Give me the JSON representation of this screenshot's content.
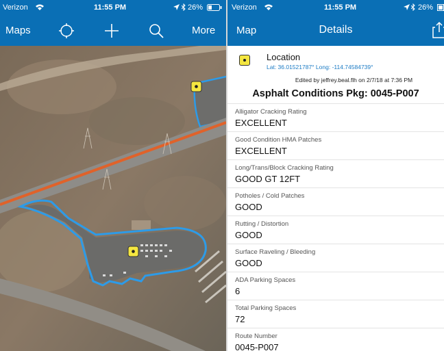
{
  "left": {
    "status": {
      "carrier": "Verizon",
      "time": "11:55 PM",
      "battery": "26%"
    },
    "nav": {
      "maps_label": "Maps",
      "more_label": "More"
    }
  },
  "right": {
    "status": {
      "carrier": "Verizon",
      "time": "11:55 PM",
      "battery": "26%"
    },
    "nav": {
      "back_label": "Map",
      "title": "Details"
    },
    "location": {
      "title": "Location",
      "coords": "Lat: 36.01521787° Long: -114.74584739°",
      "edited": "Edited by jeffrey.beal.flh on 2/7/18 at 7:36 PM"
    },
    "package_title": "Asphalt Conditions Pkg: 0045-P007",
    "fields": [
      {
        "label": "Alligator Cracking Rating",
        "value": "EXCELLENT"
      },
      {
        "label": "Good Condition HMA Patches",
        "value": "EXCELLENT"
      },
      {
        "label": "Long/Trans/Block Cracking Rating",
        "value": "GOOD GT 12FT"
      },
      {
        "label": "Potholes / Cold Patches",
        "value": "GOOD"
      },
      {
        "label": "Rutting / Distortion",
        "value": "GOOD"
      },
      {
        "label": "Surface Raveling / Bleeding",
        "value": "GOOD"
      },
      {
        "label": "ADA Parking Spaces",
        "value": "6"
      },
      {
        "label": "Total Parking Spaces",
        "value": "72"
      },
      {
        "label": "Route Number",
        "value": "0045-P007"
      }
    ]
  },
  "colors": {
    "bar": "#0a6fb5",
    "link": "#1a7ac4",
    "feature_outline": "#2d9be8",
    "road": "#e0622a",
    "marker": "#f4e640"
  },
  "icons": [
    "wifi-icon",
    "location-arrow-icon",
    "bluetooth-icon",
    "battery-icon",
    "locate-icon",
    "add-icon",
    "search-icon",
    "share-icon",
    "feature-marker-icon"
  ]
}
